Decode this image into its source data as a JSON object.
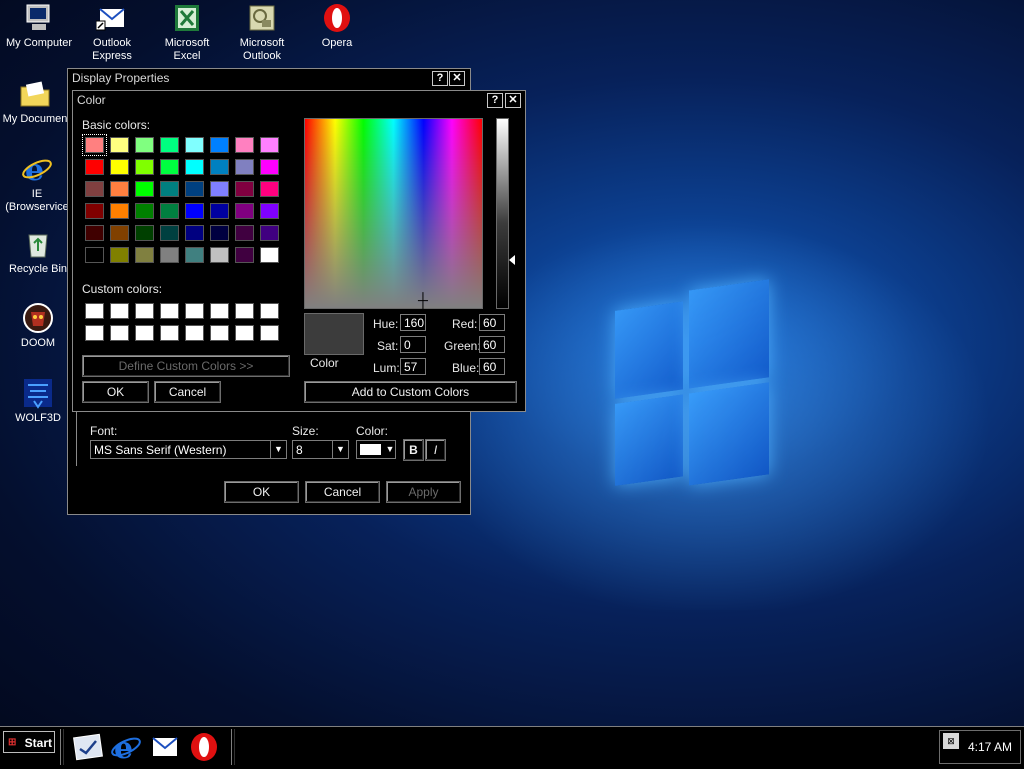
{
  "desktop": {
    "icons": [
      {
        "label": "My Computer",
        "icon": "my-computer-icon"
      },
      {
        "label": "Outlook Express",
        "line1": "Outlook",
        "line2": "Express",
        "icon": "outlook-express-icon"
      },
      {
        "label": "Microsoft Excel",
        "line1": "Microsoft",
        "line2": "Excel",
        "icon": "excel-icon"
      },
      {
        "label": "Microsoft Outlook",
        "line1": "Microsoft",
        "line2": "Outlook",
        "icon": "outlook-icon"
      },
      {
        "label": "Opera",
        "icon": "opera-icon"
      },
      {
        "label": "My Documen",
        "icon": "my-documents-icon"
      },
      {
        "label": "IE (Browservice)",
        "line1": "IE",
        "line2": "(Browservice",
        "icon": "ie-icon"
      },
      {
        "label": "Recycle Bin",
        "icon": "recycle-bin-icon"
      },
      {
        "label": "DOOM",
        "icon": "doom-icon"
      },
      {
        "label": "WOLF3D",
        "icon": "wolf3d-icon"
      }
    ]
  },
  "display_properties": {
    "title": "Display Properties",
    "help": "?",
    "close": "✕",
    "font_label": "Font:",
    "font_value": "MS Sans Serif (Western)",
    "size_label": "Size:",
    "size_value": "8",
    "color_label": "Color:",
    "bold": "B",
    "italic": "I",
    "ok": "OK",
    "cancel": "Cancel",
    "apply": "Apply"
  },
  "color_dialog": {
    "title": "Color",
    "help": "?",
    "close": "✕",
    "basic_colors_label": "Basic colors:",
    "custom_colors_label": "Custom colors:",
    "define_custom": "Define Custom Colors >>",
    "ok": "OK",
    "cancel": "Cancel",
    "color_solid_label": "Color",
    "hue_label": "Hue:",
    "hue": "160",
    "sat_label": "Sat:",
    "sat": "0",
    "lum_label": "Lum:",
    "lum": "57",
    "red_label": "Red:",
    "red": "60",
    "green_label": "Green:",
    "green": "60",
    "blue_label": "Blue:",
    "blue": "60",
    "add_custom": "Add to Custom Colors",
    "preview_color": "#3c3c3c",
    "basic_colors": [
      [
        "#ff8080",
        "#ffff80",
        "#80ff80",
        "#00ff80",
        "#80ffff",
        "#0080ff",
        "#ff80c0",
        "#ff80ff"
      ],
      [
        "#ff0000",
        "#ffff00",
        "#80ff00",
        "#00ff40",
        "#00ffff",
        "#0080c0",
        "#8080c0",
        "#ff00ff"
      ],
      [
        "#804040",
        "#ff8040",
        "#00ff00",
        "#008080",
        "#004080",
        "#8080ff",
        "#800040",
        "#ff0080"
      ],
      [
        "#800000",
        "#ff8000",
        "#008000",
        "#008040",
        "#0000ff",
        "#0000a0",
        "#800080",
        "#8000ff"
      ],
      [
        "#400000",
        "#804000",
        "#004000",
        "#004040",
        "#000080",
        "#000040",
        "#400040",
        "#400080"
      ],
      [
        "#000000",
        "#808000",
        "#808040",
        "#808080",
        "#408080",
        "#c0c0c0",
        "#400040",
        "#ffffff"
      ]
    ],
    "custom_colors": [
      [
        "#ffffff",
        "#ffffff",
        "#ffffff",
        "#ffffff",
        "#ffffff",
        "#ffffff",
        "#ffffff",
        "#ffffff"
      ],
      [
        "#ffffff",
        "#ffffff",
        "#ffffff",
        "#ffffff",
        "#ffffff",
        "#ffffff",
        "#ffffff",
        "#ffffff"
      ]
    ]
  },
  "taskbar": {
    "start": "Start",
    "quick_launch": [
      "show-desktop-icon",
      "ie-icon",
      "outlook-express-icon",
      "opera-icon"
    ],
    "clock": "4:17 AM"
  }
}
